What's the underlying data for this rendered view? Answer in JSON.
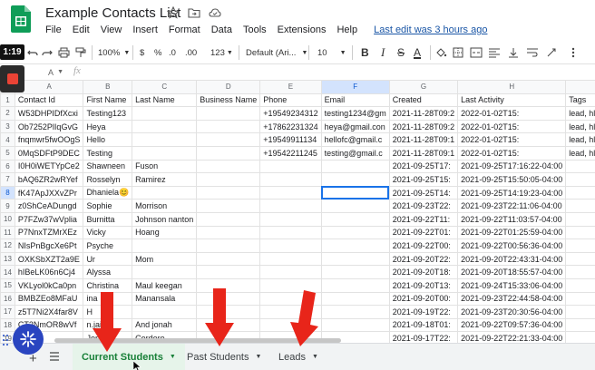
{
  "app": {
    "title": "Example Contacts List",
    "last_edit": "Last edit was 3 hours ago",
    "menu": [
      "File",
      "Edit",
      "View",
      "Insert",
      "Format",
      "Data",
      "Tools",
      "Extensions",
      "Help"
    ]
  },
  "overlay": {
    "timer": "1:19"
  },
  "toolbar": {
    "zoom": "100%",
    "currency": "$",
    "percent": "%",
    "dec_decrease": ".0",
    "dec_increase": ".00",
    "more_formats": "123",
    "font": "Default (Ari...",
    "font_size": "10",
    "bold": "B",
    "italic": "I",
    "strike": "S",
    "text_color": "A"
  },
  "formula_bar": {
    "cell_ref": "A",
    "fx": "fx"
  },
  "grid": {
    "columns": [
      "A",
      "B",
      "C",
      "D",
      "E",
      "F",
      "G",
      "H",
      "I"
    ],
    "selected_column": "F",
    "selected_row": 8,
    "rows": [
      {
        "n": 1,
        "cells": [
          "Contact Id",
          "First Name",
          "Last Name",
          "Business Name",
          "Phone",
          "Email",
          "Created",
          "Last Activity",
          "Tags"
        ]
      },
      {
        "n": 2,
        "cells": [
          "W53DHPIDfXcxi",
          "Testing123",
          "",
          "",
          "+19549234312",
          "testing1234@gm",
          "2021-11-28T09:2",
          "2022-01-02T15:",
          "lead, hl, fb, ads"
        ]
      },
      {
        "n": 3,
        "cells": [
          "Ob7252PlIqGvG",
          "Heya",
          "",
          "",
          "+17862231324",
          "heya@gmail.con",
          "2021-11-28T09:2",
          "2022-01-02T15:",
          "lead, hl, fb, ads"
        ]
      },
      {
        "n": 4,
        "cells": [
          "fnqmwr5fwOOgS",
          "Hello",
          "",
          "",
          "+19549911134",
          "hellofc@gmail.c",
          "2021-11-28T09:1",
          "2022-01-02T15:",
          "lead, hl, fb, ads"
        ]
      },
      {
        "n": 5,
        "cells": [
          "0MqSDFtP9DEC",
          "Testing",
          "",
          "",
          "+19542211245",
          "testing@gmail.c",
          "2021-11-28T09:1",
          "2022-01-02T15:",
          "lead, hl, fb, ads"
        ]
      },
      {
        "n": 6,
        "cells": [
          "I0H0iWETYpCe2",
          "Shawneen",
          "Fuson",
          "",
          "",
          "",
          "2021-09-25T17:",
          "2021-09-25T17:16:22-04:00",
          ""
        ]
      },
      {
        "n": 7,
        "cells": [
          "bAQ6ZR2wRYef",
          "Rosselyn",
          "Ramirez",
          "",
          "",
          "",
          "2021-09-25T15:",
          "2021-09-25T15:50:05-04:00",
          ""
        ]
      },
      {
        "n": 8,
        "cells": [
          "fK47ApJXXvZPr",
          "Dhaniela😊",
          "",
          "",
          "",
          "",
          "2021-09-25T14:",
          "2021-09-25T14:19:23-04:00",
          ""
        ]
      },
      {
        "n": 9,
        "cells": [
          "z0ShCeADungd",
          "Sophie",
          "Morrison",
          "",
          "",
          "",
          "2021-09-23T22:",
          "2021-09-23T22:11:06-04:00",
          ""
        ]
      },
      {
        "n": 10,
        "cells": [
          "P7FZw37wVplia",
          "Burnitta",
          "Johnson nanton",
          "",
          "",
          "",
          "2021-09-22T11:",
          "2021-09-22T11:03:57-04:00",
          ""
        ]
      },
      {
        "n": 11,
        "cells": [
          "P7NnxTZMrXEz",
          "Vicky",
          "Hoang",
          "",
          "",
          "",
          "2021-09-22T01:",
          "2021-09-22T01:25:59-04:00",
          ""
        ]
      },
      {
        "n": 12,
        "cells": [
          "NIsPnBgcXe6Pt",
          "Psyche",
          "",
          "",
          "",
          "",
          "2021-09-22T00:",
          "2021-09-22T00:56:36-04:00",
          ""
        ]
      },
      {
        "n": 13,
        "cells": [
          "OXKSbXZT2a9E",
          "Ur",
          "Mom",
          "",
          "",
          "",
          "2021-09-20T22:",
          "2021-09-20T22:43:31-04:00",
          ""
        ]
      },
      {
        "n": 14,
        "cells": [
          "hIBeLK06n6Cj4",
          "Alyssa",
          "",
          "",
          "",
          "",
          "2021-09-20T18:",
          "2021-09-20T18:55:57-04:00",
          ""
        ]
      },
      {
        "n": 15,
        "cells": [
          "VKLyol0kCa0pn",
          "Christina",
          "Maul keegan",
          "",
          "",
          "",
          "2021-09-20T13:",
          "2021-09-24T15:33:06-04:00",
          ""
        ]
      },
      {
        "n": 16,
        "cells": [
          "BMBZEo8MFaU",
          "ina",
          "Manansala",
          "",
          "",
          "",
          "2021-09-20T00:",
          "2021-09-23T22:44:58-04:00",
          ""
        ]
      },
      {
        "n": 17,
        "cells": [
          "z5T7Ni2X4far8V",
          "H",
          "",
          "",
          "",
          "",
          "2021-09-19T22:",
          "2021-09-23T20:30:56-04:00",
          ""
        ]
      },
      {
        "n": 18,
        "cells": [
          "CT2NmOR8wVf",
          "n.jaiea",
          "And jonah",
          "",
          "",
          "",
          "2021-09-18T01:",
          "2021-09-22T09:57:36-04:00",
          ""
        ]
      },
      {
        "n": 19,
        "cells": [
          "",
          "Jorge",
          "Cordero",
          "",
          "",
          "",
          "2021-09-17T22:",
          "2021-09-22T22:21:33-04:00",
          ""
        ]
      }
    ]
  },
  "sheet_tabs": [
    {
      "label": "Current Students",
      "active": true
    },
    {
      "label": "Past Students",
      "active": false
    },
    {
      "label": "Leads",
      "active": false
    }
  ],
  "colors": {
    "accent": "#1a73e8",
    "active_tab_text": "#188038",
    "active_tab_bg": "#e6f4ea",
    "arrow": "#e8251a",
    "fab": "#2a45c0"
  }
}
